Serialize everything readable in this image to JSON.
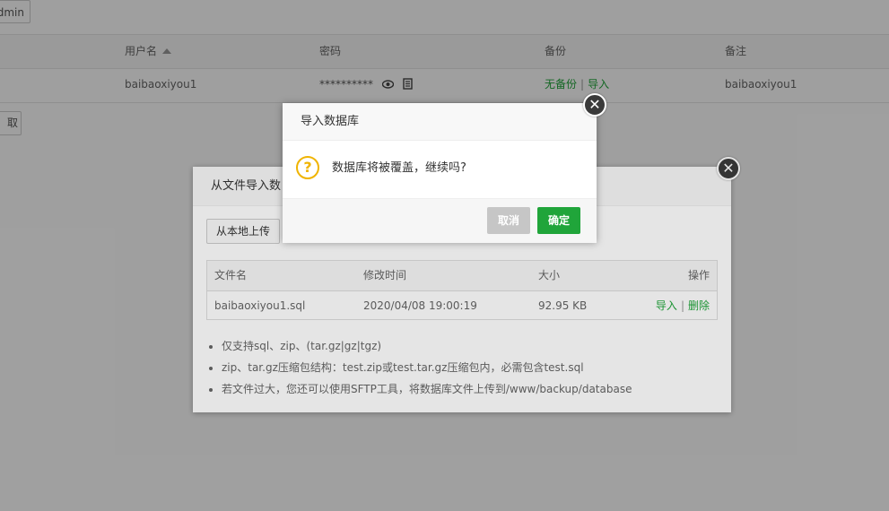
{
  "background": {
    "admin_button": "dmin",
    "table": {
      "headers": {
        "username": "用户名",
        "password": "密码",
        "backup": "备份",
        "remark": "备注"
      },
      "row": {
        "username": "baibaoxiyou1",
        "password_mask": "**********",
        "backup_status": "无备份",
        "backup_sep": "|",
        "backup_import": "导入",
        "remark": "baibaoxiyou1"
      }
    },
    "cancel_button": "取"
  },
  "import_dialog": {
    "title": "从文件导入数",
    "close_glyph": "✕",
    "upload_button": "从本地上传",
    "file_table": {
      "headers": [
        "文件名",
        "修改时间",
        "大小",
        "操作"
      ],
      "rows": [
        {
          "name": "baibaoxiyou1.sql",
          "mtime": "2020/04/08 19:00:19",
          "size": "92.95 KB",
          "import": "导入",
          "sep": "|",
          "delete": "删除"
        }
      ]
    },
    "tips": [
      "仅支持sql、zip、(tar.gz|gz|tgz)",
      "zip、tar.gz压缩包结构：test.zip或test.tar.gz压缩包内，必需包含test.sql",
      "若文件过大，您还可以使用SFTP工具，将数据库文件上传到/www/backup/database"
    ]
  },
  "confirm_dialog": {
    "title": "导入数据库",
    "close_glyph": "✕",
    "icon": "question-icon",
    "icon_glyph": "?",
    "message": "数据库将被覆盖，继续吗?",
    "cancel_label": "取消",
    "ok_label": "确定"
  },
  "colors": {
    "accent_green": "#20a53a",
    "warning": "#f0b400"
  }
}
